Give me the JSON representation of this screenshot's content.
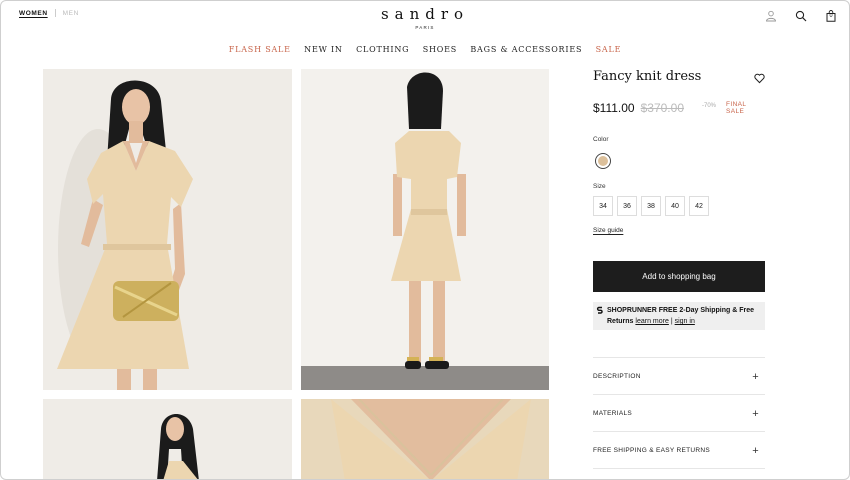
{
  "header": {
    "gender_tabs": [
      "WOMEN",
      "MEN"
    ],
    "brand": "sandro",
    "brand_city": "PARIS",
    "icons": [
      "account-icon",
      "search-icon",
      "bag-icon"
    ],
    "bag_count": "0"
  },
  "nav": {
    "items": [
      "FLASH SALE",
      "NEW IN",
      "CLOTHING",
      "SHOES",
      "BAGS & ACCESSORIES",
      "SALE"
    ],
    "accent_color": "#c8654b"
  },
  "product": {
    "title": "Fancy knit dress",
    "price": "$111.00",
    "original_price": "$370.00",
    "discount": "-70%",
    "final_sale_line1": "FINAL",
    "final_sale_line2": "SALE",
    "color_label": "Color",
    "color_swatch": "#dcc09b",
    "size_label": "Size",
    "sizes": [
      "34",
      "36",
      "38",
      "40",
      "42"
    ],
    "size_guide": "Size guide",
    "add_to_bag": "Add to shopping bag",
    "shoprunner": {
      "bold_text": "SHOPRUNNER FREE 2-Day Shipping & Free Returns",
      "learn_more": "learn more",
      "divider": "|",
      "sign_in": "sign in"
    },
    "accordions": [
      "DESCRIPTION",
      "MATERIALS",
      "FREE SHIPPING & EASY RETURNS"
    ]
  },
  "colors": {
    "dress": "#ecd6b0",
    "button_bg": "#1d1d1d"
  }
}
